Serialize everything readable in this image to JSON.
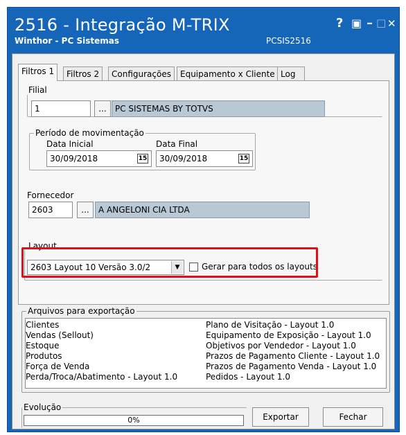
{
  "window": {
    "title": "2516 - Integração M-TRIX",
    "subtitle": "Winthor - PC Sistemas",
    "code": "PCSIS2516"
  },
  "titlebar_buttons": {
    "help": "?",
    "restore": "▣",
    "minimize": "–",
    "maximize": "□",
    "close": "✕"
  },
  "tabs": [
    "Filtros 1",
    "Filtros 2",
    "Configurações",
    "Equipamento x Cliente",
    "Log"
  ],
  "filial": {
    "label": "Filial",
    "code": "1",
    "lookup_label": "...",
    "name": "PC SISTEMAS BY TOTVS"
  },
  "periodo": {
    "label": "Período de movimentação",
    "start_label": "Data Inicial",
    "start_value": "30/09/2018",
    "end_label": "Data Final",
    "end_value": "30/09/2018",
    "calendar_glyph": "15"
  },
  "fornecedor": {
    "label": "Fornecedor",
    "code": "2603",
    "lookup_label": "...",
    "name": "A ANGELONI CIA LTDA"
  },
  "layout": {
    "label": "Layout",
    "selected": "2603 Layout 10 Versão 3.0/2",
    "checkbox_label": "Gerar para todos os layouts",
    "checkbox_checked": false
  },
  "arquivos": {
    "label": "Arquivos para exportação",
    "left": [
      "Clientes",
      "Vendas (Sellout)",
      "Estoque",
      "Produtos",
      "Força de Venda",
      "Perda/Troca/Abatimento - Layout 1.0"
    ],
    "right": [
      "Plano de Visitação - Layout 1.0",
      "Equipamento de Exposição - Layout 1.0",
      "Objetivos por Vendedor - Layout 1.0",
      "Prazos de Pagamento Cliente - Layout 1.0",
      "Prazos de Pagamento Venda - Layout 1.0",
      "Pedidos - Layout 1.0"
    ]
  },
  "evolucao": {
    "label": "Evolução",
    "progress_text": "0%",
    "progress_fraction": 0
  },
  "actions": {
    "export": "Exportar",
    "close": "Fechar"
  },
  "colors": {
    "titlebar": "#1565b8",
    "highlight": "#e0101a",
    "readonly_field": "#b8c8d4"
  }
}
